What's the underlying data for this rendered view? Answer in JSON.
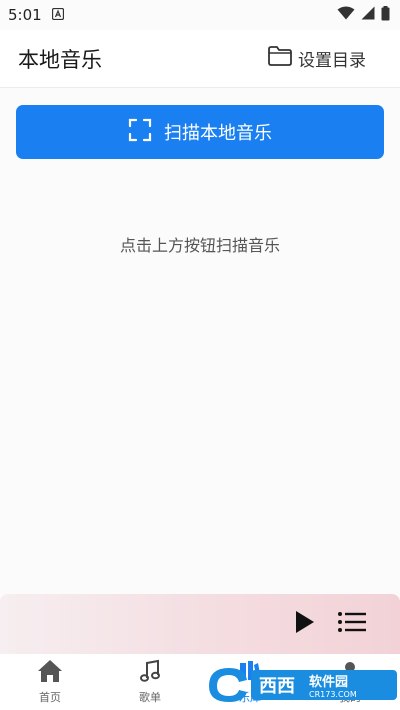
{
  "status_bar": {
    "time": "5:01",
    "notification_icon": "a-box-icon",
    "icons": [
      "wifi-icon",
      "signal-icon",
      "battery-icon"
    ]
  },
  "header": {
    "title": "本地音乐",
    "set_dir_label": "设置目录",
    "set_dir_icon": "folder-icon"
  },
  "scan_button": {
    "label": "扫描本地音乐",
    "icon": "scan-frame-icon",
    "color": "#1a7ff0"
  },
  "hint": "点击上方按钮扫描音乐",
  "player": {
    "play_icon": "play-icon",
    "playlist_icon": "playlist-icon"
  },
  "nav": {
    "items": [
      {
        "label": "首页",
        "icon": "home-icon"
      },
      {
        "label": "歌单",
        "icon": "music-note-icon"
      },
      {
        "label": "乐库",
        "icon": "library-icon",
        "active": true
      },
      {
        "label": "我的",
        "icon": "user-icon"
      }
    ]
  },
  "watermark": {
    "text": "西西软件园",
    "subtext": "CR173.COM"
  }
}
